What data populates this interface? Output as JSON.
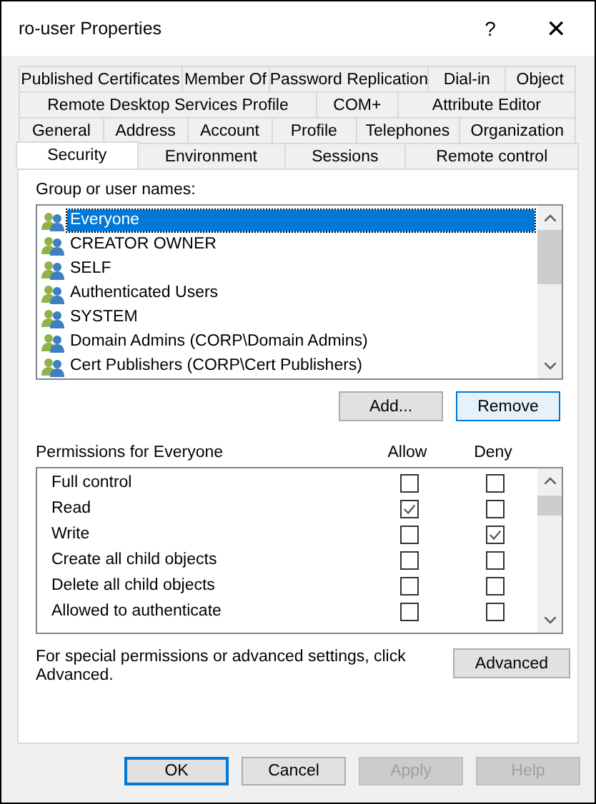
{
  "window": {
    "title": "ro-user Properties",
    "help_glyph": "?",
    "close_glyph": "✕"
  },
  "tab_rows": [
    [
      {
        "label": "Published Certificates",
        "selected": false
      },
      {
        "label": "Member Of",
        "selected": false
      },
      {
        "label": "Password Replication",
        "selected": false
      },
      {
        "label": "Dial-in",
        "selected": false
      },
      {
        "label": "Object",
        "selected": false
      }
    ],
    [
      {
        "label": "Remote Desktop Services Profile",
        "selected": false
      },
      {
        "label": "COM+",
        "selected": false
      },
      {
        "label": "Attribute Editor",
        "selected": false
      }
    ],
    [
      {
        "label": "General",
        "selected": false
      },
      {
        "label": "Address",
        "selected": false
      },
      {
        "label": "Account",
        "selected": false
      },
      {
        "label": "Profile",
        "selected": false
      },
      {
        "label": "Telephones",
        "selected": false
      },
      {
        "label": "Organization",
        "selected": false
      }
    ],
    [
      {
        "label": "Security",
        "selected": true
      },
      {
        "label": "Environment",
        "selected": false
      },
      {
        "label": "Sessions",
        "selected": false
      },
      {
        "label": "Remote control",
        "selected": false
      }
    ]
  ],
  "groups": {
    "label": "Group or user names:",
    "items": [
      {
        "name": "Everyone",
        "selected": true
      },
      {
        "name": "CREATOR OWNER",
        "selected": false
      },
      {
        "name": "SELF",
        "selected": false
      },
      {
        "name": "Authenticated Users",
        "selected": false
      },
      {
        "name": "SYSTEM",
        "selected": false
      },
      {
        "name": "Domain Admins (CORP\\Domain Admins)",
        "selected": false
      },
      {
        "name": "Cert Publishers (CORP\\Cert Publishers)",
        "selected": false
      }
    ],
    "buttons": [
      "Add...",
      "Remove"
    ]
  },
  "permissions": {
    "label": "Permissions for Everyone",
    "allow_header": "Allow",
    "deny_header": "Deny",
    "rows": [
      {
        "name": "Full control",
        "allow": false,
        "deny": false
      },
      {
        "name": "Read",
        "allow": true,
        "deny": false
      },
      {
        "name": "Write",
        "allow": false,
        "deny": true
      },
      {
        "name": "Create all child objects",
        "allow": false,
        "deny": false
      },
      {
        "name": "Delete all child objects",
        "allow": false,
        "deny": false
      },
      {
        "name": "Allowed to authenticate",
        "allow": false,
        "deny": false
      }
    ]
  },
  "advanced": {
    "text": "For special permissions or advanced settings, click Advanced.",
    "button": "Advanced"
  },
  "footer_buttons": [
    {
      "label": "OK",
      "default": true,
      "disabled": false
    },
    {
      "label": "Cancel",
      "default": false,
      "disabled": false
    },
    {
      "label": "Apply",
      "default": false,
      "disabled": true
    },
    {
      "label": "Help",
      "default": false,
      "disabled": true
    }
  ]
}
